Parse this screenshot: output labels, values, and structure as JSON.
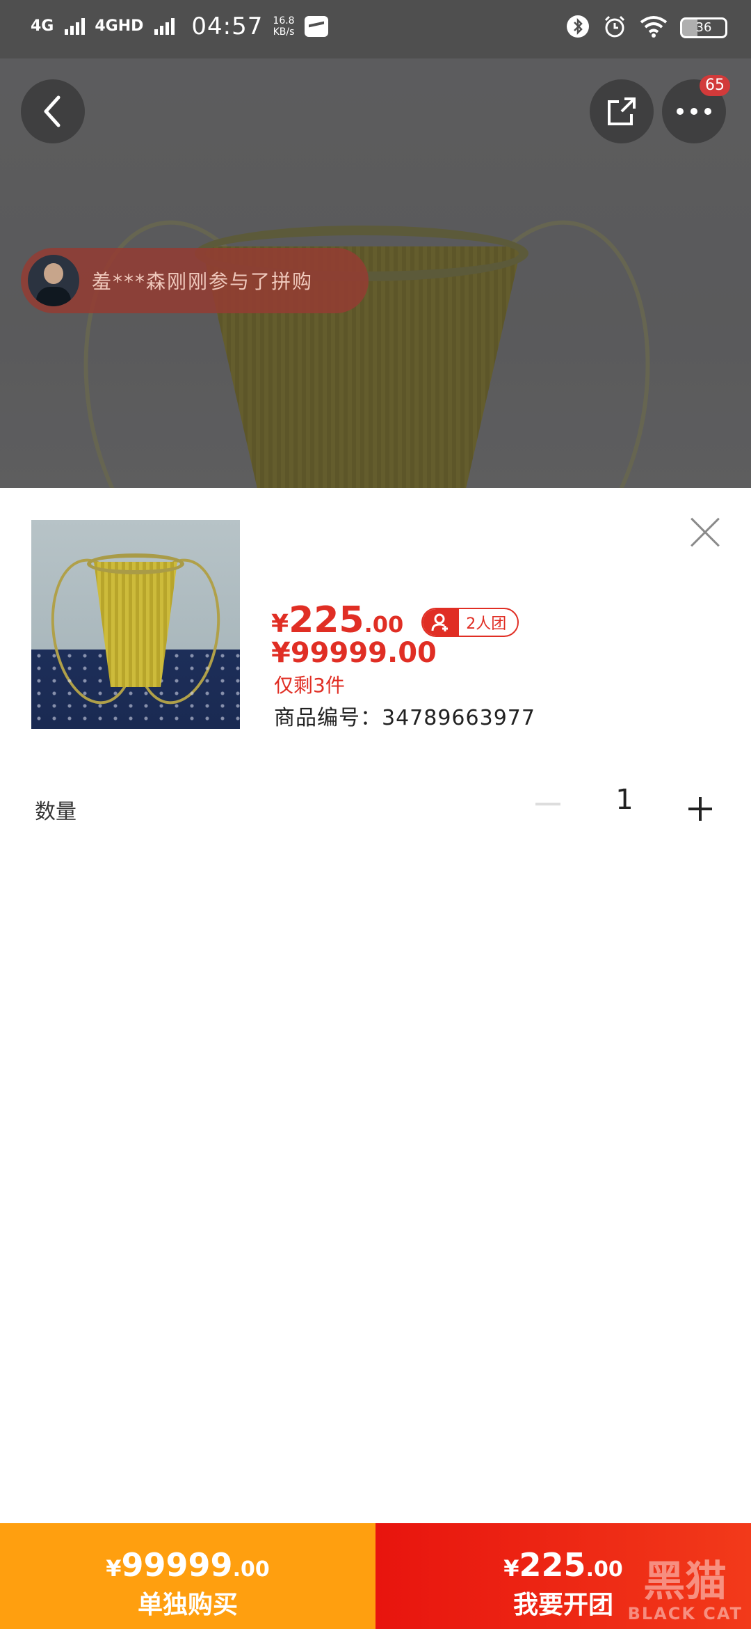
{
  "status_bar": {
    "network1": "4G",
    "network2": "4GHD",
    "time": "04:57",
    "speed_value": "16.8",
    "speed_unit": "KB/s",
    "battery": "36"
  },
  "top": {
    "more_badge": "65",
    "join_notice": "羞***森刚刚参与了拼购"
  },
  "product": {
    "price_symbol": "¥",
    "price_int": "225",
    "price_dec": ".00",
    "group_tag": "2人团",
    "original_price": "¥99999.00",
    "stock_text": "仅剩3件",
    "sku_text": "商品编号：34789663977"
  },
  "quantity": {
    "label": "数量",
    "value": "1"
  },
  "bottom_bar": {
    "solo_price_int": "99999",
    "solo_price_dec": ".00",
    "solo_label": "单独购买",
    "group_price_int": "225",
    "group_price_dec": ".00",
    "group_label": "我要开团",
    "symbol": "¥"
  },
  "watermark": {
    "cn": "黑猫",
    "en": "BLACK CAT"
  }
}
